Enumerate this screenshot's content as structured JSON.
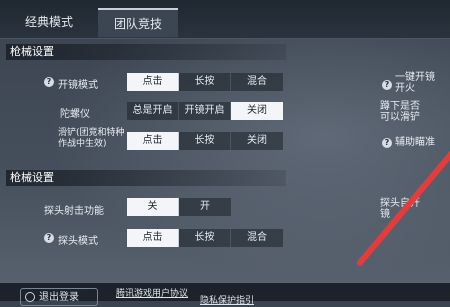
{
  "tabs": [
    {
      "label": "经典模式",
      "active": false
    },
    {
      "label": "团队竞技",
      "active": true
    }
  ],
  "sections": [
    {
      "title": "枪械设置"
    },
    {
      "title": "枪械设置"
    }
  ],
  "rows": {
    "scope_mode": {
      "label": "开镜模式",
      "options": [
        "点击",
        "长按",
        "混合"
      ],
      "selected": "点击"
    },
    "gyroscope": {
      "label": "陀螺仪",
      "options": [
        "总是开启",
        "开镜开启",
        "关闭"
      ],
      "selected": "关闭"
    },
    "slide": {
      "label": "滑铲(团竞和特种作战中生效)",
      "options": [
        "点击",
        "长按",
        "关闭"
      ],
      "selected": "点击"
    },
    "peek_fire": {
      "label": "探头射击功能",
      "options": [
        "关",
        "开"
      ],
      "selected": "关"
    },
    "peek_mode": {
      "label": "探头模式",
      "options": [
        "点击",
        "长按",
        "混合"
      ],
      "selected": "点击"
    }
  },
  "right_notes": {
    "one_key_scope": "一键开镜开火",
    "crouch_slide": "蹲下是否可以滑铲",
    "assist_aim": "辅助瞄准",
    "peek_scope": "探头自开镜"
  },
  "bottom": {
    "logout": "退出登录",
    "link1": "腾讯游戏用户协议",
    "link2": "隐私保护指引"
  },
  "colors": {
    "annotation_stroke": "#e43c3c",
    "selected_bg": "#f3f5f8"
  }
}
